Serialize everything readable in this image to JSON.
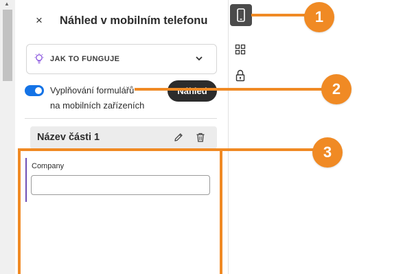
{
  "panel": {
    "title": "Náhled v mobilním telefonu",
    "close_label": "×"
  },
  "how_it_works": {
    "label": "JAK TO FUNGUJE"
  },
  "mobile_fill": {
    "line1": "Vyplňování formulářů",
    "line2": "na mobilních zařízeních",
    "enabled": true,
    "preview_button": "Náhled"
  },
  "section": {
    "title": "Název části 1"
  },
  "field": {
    "label": "Company",
    "value": ""
  },
  "annotations": {
    "one": "1",
    "two": "2",
    "three": "3"
  },
  "colors": {
    "accent": "#1473e6",
    "annotation": "#f08a24",
    "field_bar": "#6e4fb5"
  }
}
